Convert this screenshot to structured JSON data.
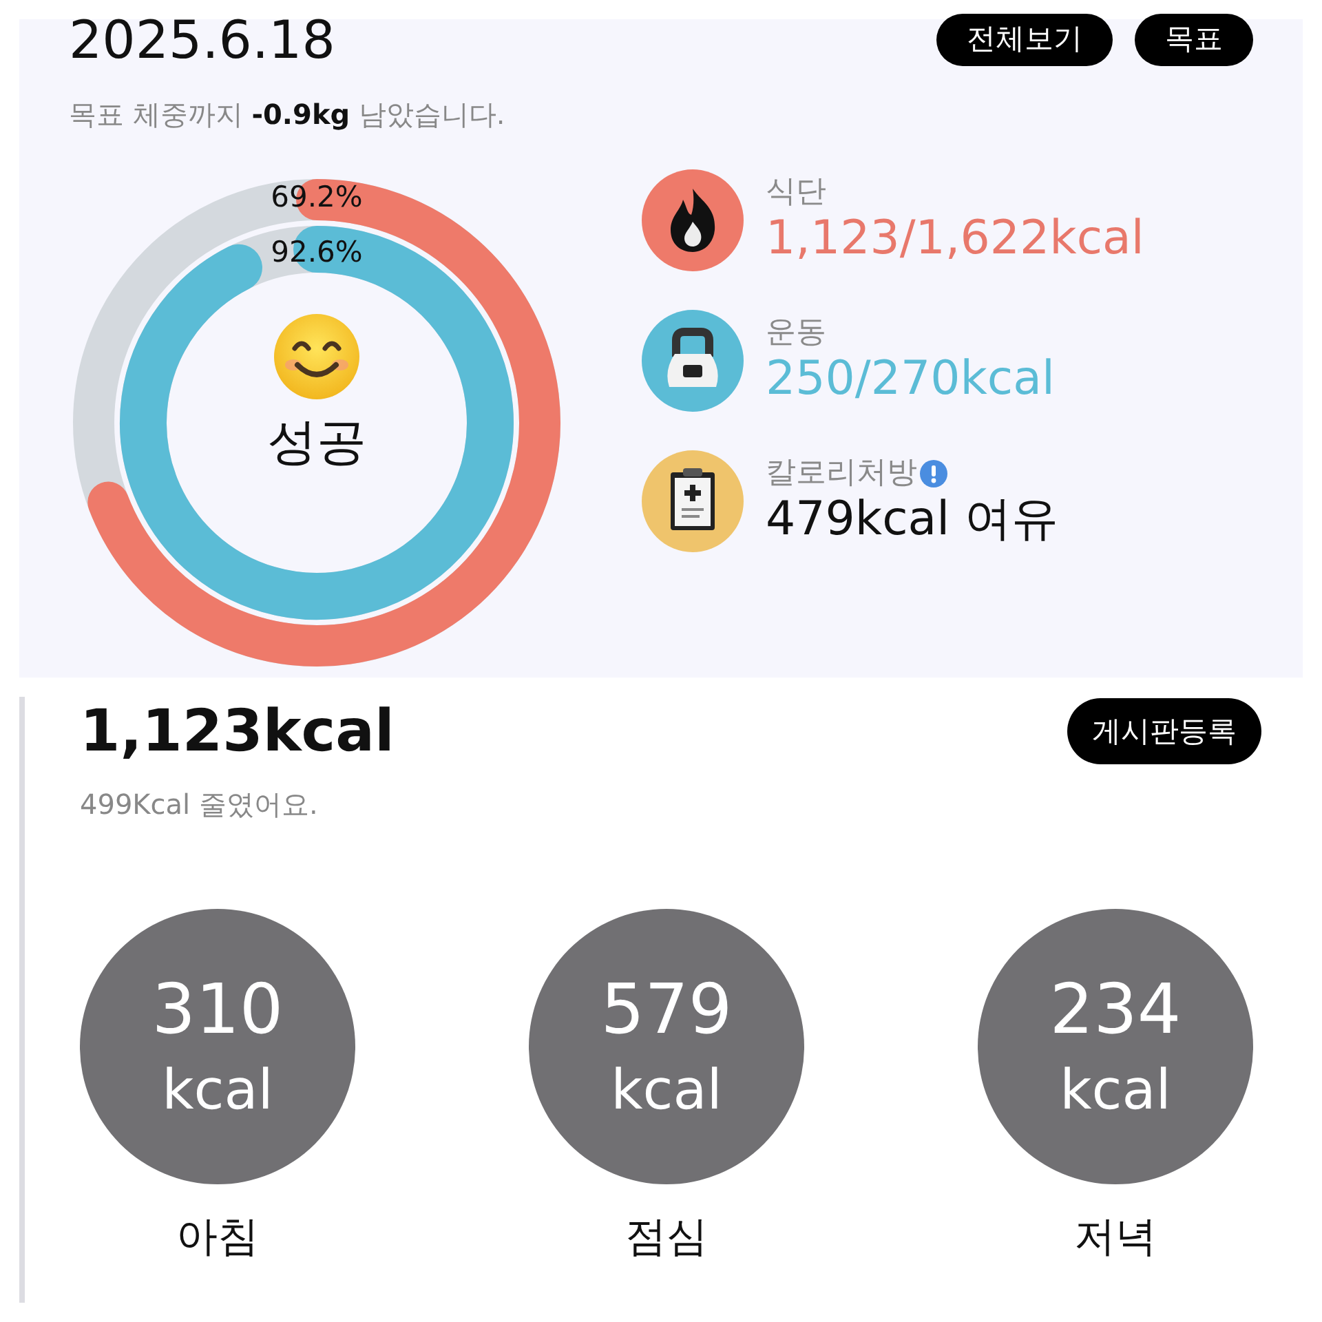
{
  "header": {
    "date": "2025.6.18",
    "buttons": [
      "전체보기",
      "목표"
    ],
    "goal_message": "목표 체중까지 **-0.9kg** 남았습니다."
  },
  "rings": [
    {
      "label": "69.2%",
      "color": "#ee7a6a"
    },
    {
      "label": "92.6%",
      "color": "#5bbcd6"
    }
  ],
  "status": {
    "text": "성공"
  },
  "stats": [
    {
      "kind": "diet",
      "label": "식단",
      "value": "1,123/1,622kcal",
      "color": "#e8786b",
      "alert": false
    },
    {
      "kind": "exercise",
      "label": "운동",
      "value": "250/270kcal",
      "color": "#5bbcd6",
      "alert": false
    },
    {
      "kind": "prescription",
      "label": "칼로리처방",
      "value": "479kcal 여유",
      "color": "#111111",
      "alert": true
    }
  ],
  "summary": {
    "total": "1,123kcal",
    "button": "게시판등록",
    "note": "499Kcal 줄였어요."
  },
  "meals": [
    {
      "value": "310",
      "unit": "kcal",
      "label": "아침"
    },
    {
      "value": "579",
      "unit": "kcal",
      "label": "점심"
    },
    {
      "value": "234",
      "unit": "kcal",
      "label": "저녁"
    }
  ]
}
